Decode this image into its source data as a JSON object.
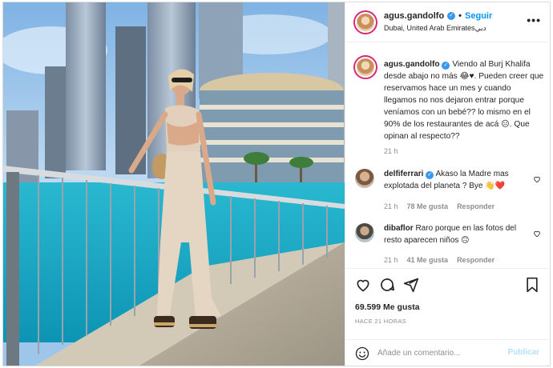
{
  "post": {
    "username": "agus.gandolfo",
    "follow_label": "Seguir",
    "separator": "•",
    "location": "Dubai, United Arab Emiratesدبي",
    "caption_text": "Viendo al Burj Khalifa desde abajo no más 😂♥. Pueden creer que reservamos hace un mes y cuando llegamos no nos dejaron entrar porque veníamos con un bebé?? lo mismo en el 90% de los restaurantes de acá 😑. Que opinan al respecto??",
    "caption_time": "21 h"
  },
  "comments": [
    {
      "username": "delfiferrari",
      "text": "Akaso la Madre mas explotada del planeta ? Bye 👋❤️",
      "time": "21 h",
      "likes": "78 Me gusta",
      "reply": "Responder"
    },
    {
      "username": "dibaflor",
      "text": "Raro porque en las fotos del resto aparecen niños 🙃",
      "time": "21 h",
      "likes": "41 Me gusta",
      "reply": "Responder"
    }
  ],
  "stats": {
    "likes": "69.599 Me gusta",
    "ago": "HACE 21 HORAS"
  },
  "add_comment": {
    "placeholder": "Añade un comentario...",
    "publish_label": "Publicar"
  },
  "icons": {
    "more": "more-options-icon",
    "like": "heart-icon",
    "comment": "comment-icon",
    "share": "share-icon",
    "save": "bookmark-icon",
    "emoji": "emoji-icon"
  },
  "colors": {
    "accent": "#0095f6",
    "verified": "#3897f0",
    "publish_disabled": "#b2dffc"
  }
}
